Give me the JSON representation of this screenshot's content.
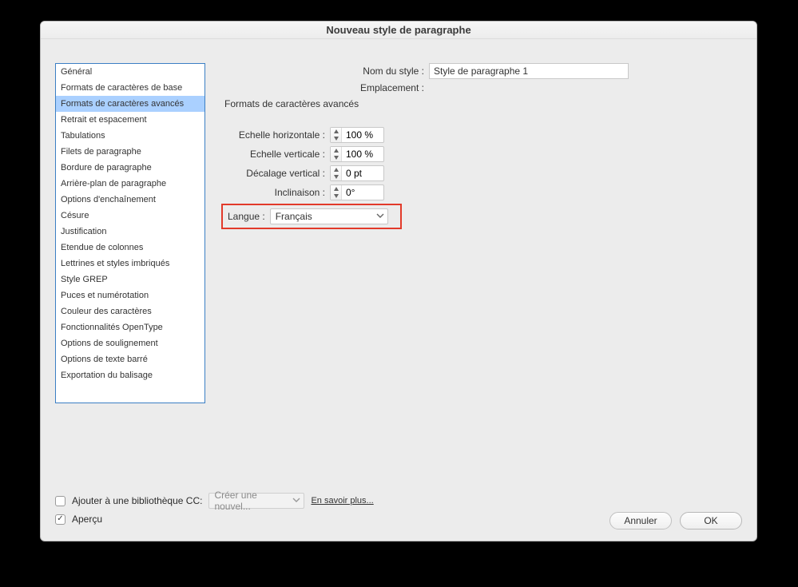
{
  "window": {
    "title": "Nouveau style de paragraphe"
  },
  "top": {
    "style_name_label": "Nom du style :",
    "style_name_value": "Style de paragraphe 1",
    "location_label": "Emplacement :"
  },
  "sidebar": {
    "items": [
      "Général",
      "Formats de caractères de base",
      "Formats de caractères avancés",
      "Retrait et espacement",
      "Tabulations",
      "Filets de paragraphe",
      "Bordure de paragraphe",
      "Arrière-plan de paragraphe",
      "Options d'enchaînement",
      "Césure",
      "Justification",
      "Etendue de colonnes",
      "Lettrines et styles imbriqués",
      "Style GREP",
      "Puces et numérotation",
      "Couleur des caractères",
      "Fonctionnalités OpenType",
      "Options de soulignement",
      "Options de texte barré",
      "Exportation du balisage"
    ],
    "selected_index": 2
  },
  "panel": {
    "section_title": "Formats de caractères avancés",
    "fields": {
      "h_scale_label": "Echelle horizontale :",
      "h_scale_value": "100 %",
      "v_scale_label": "Echelle verticale :",
      "v_scale_value": "100 %",
      "baseline_label": "Décalage vertical :",
      "baseline_value": "0 pt",
      "skew_label": "Inclinaison :",
      "skew_value": "0°"
    },
    "language_label": "Langue :",
    "language_value": "Français"
  },
  "footer": {
    "add_cc_label": "Ajouter à une bibliothèque CC:",
    "cc_select_value": "Créer une nouvel...",
    "learn_more": "En savoir plus...",
    "preview_label": "Aperçu",
    "cancel": "Annuler",
    "ok": "OK"
  }
}
